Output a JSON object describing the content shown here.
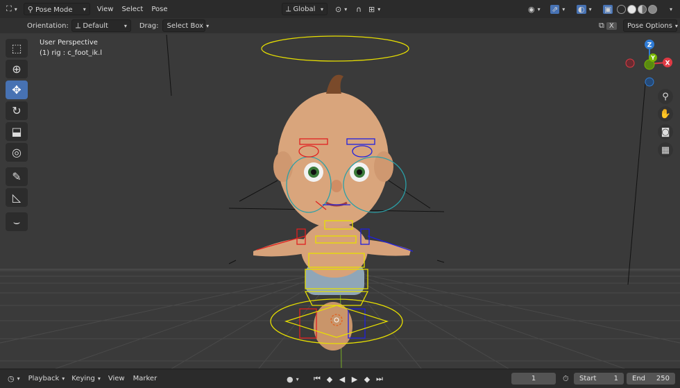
{
  "header": {
    "editor_type_icon": "object-mode-icon",
    "mode_label": "Pose Mode",
    "menus": [
      "View",
      "Select",
      "Pose"
    ],
    "transform_orientation": "Global"
  },
  "tool_settings": {
    "orientation_label": "Orientation:",
    "orientation_value": "Default",
    "drag_label": "Drag:",
    "drag_value": "Select Box",
    "x_mirror_label": "X",
    "pose_options_label": "Pose Options"
  },
  "viewport": {
    "perspective_label": "User Perspective",
    "active_object_label": "(1) rig : c_foot_ik.l",
    "gizmo_axes": {
      "z": "Z",
      "y": "Y",
      "x": "X"
    }
  },
  "toolbar": {
    "tools": [
      "select-box-icon",
      "cursor-icon",
      "move-icon",
      "rotate-icon",
      "scale-icon",
      "transform-icon",
      "annotate-icon",
      "measure-icon",
      "bone-curve-icon"
    ],
    "active_tool": "move-icon"
  },
  "timeline": {
    "menus": [
      "Playback",
      "Keying",
      "View",
      "Marker"
    ],
    "current_frame": "1",
    "start_label": "Start",
    "start_value": "1",
    "end_label": "End",
    "end_value": "250"
  },
  "colors": {
    "accent": "#4772b3",
    "header_bg": "#2b2b2b",
    "viewport_bg": "#3a3a3a",
    "axis_x": "#e03a44",
    "axis_y": "#7ab800",
    "axis_z": "#2f7cd6"
  }
}
